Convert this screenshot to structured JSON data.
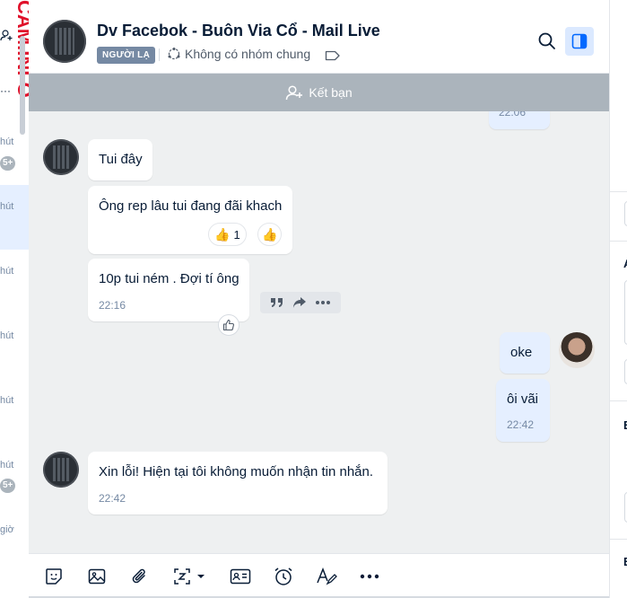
{
  "watermark": {
    "text": "CAM.INFO"
  },
  "left_strip": {
    "items": [
      {
        "time": "hút",
        "badge": "5+"
      },
      {
        "time": "hút",
        "badge": ""
      },
      {
        "time": "hút",
        "badge": ""
      },
      {
        "time": "hút",
        "badge": ""
      },
      {
        "time": "hút",
        "badge": ""
      },
      {
        "time": "hút",
        "badge": "5+"
      },
      {
        "time": "giờ",
        "badge": ""
      }
    ]
  },
  "header": {
    "title": "Dv Facebok - Buôn Via Cổ - Mail Live",
    "badge": "NGƯỜI LẠ",
    "group_info": "Không có nhóm chung",
    "icons": {
      "search": "search-icon",
      "panel": "sidebar-panel-icon",
      "tag": "tag-icon",
      "group": "group-icon"
    }
  },
  "friend_bar": {
    "label": "Kết bạn",
    "icon": "add-friend-icon"
  },
  "messages": {
    "partial_top_time": "22:06",
    "m1": {
      "text": "Tui đây"
    },
    "m2": {
      "text": "Ông rep lâu tui đang đãi khach",
      "reaction_count": "1"
    },
    "m3": {
      "text": "10p tui ném . Đợi tí ông",
      "time": "22:16"
    },
    "m4": {
      "text": "oke"
    },
    "m5": {
      "text": "ôi vãi",
      "time": "22:42"
    },
    "m6": {
      "text": "Xin lỗi! Hiện tại tôi không muốn nhận tin nhắn.",
      "time": "22:42"
    }
  },
  "message_actions": [
    "quote-icon",
    "forward-icon",
    "more-icon"
  ],
  "toolbar": {
    "icons": [
      "sticker-icon",
      "image-icon",
      "attachment-icon",
      "screenshot-icon",
      "contact-card-icon",
      "reminder-icon",
      "format-text-icon",
      "more-icon"
    ]
  },
  "right_strip": {
    "letters": [
      "A",
      "E",
      "E"
    ]
  },
  "colors": {
    "accent": "#0068ff",
    "chat_bg": "#eef0f1",
    "my_bubble": "#e5efff",
    "friend_bar": "#abb4bc"
  }
}
